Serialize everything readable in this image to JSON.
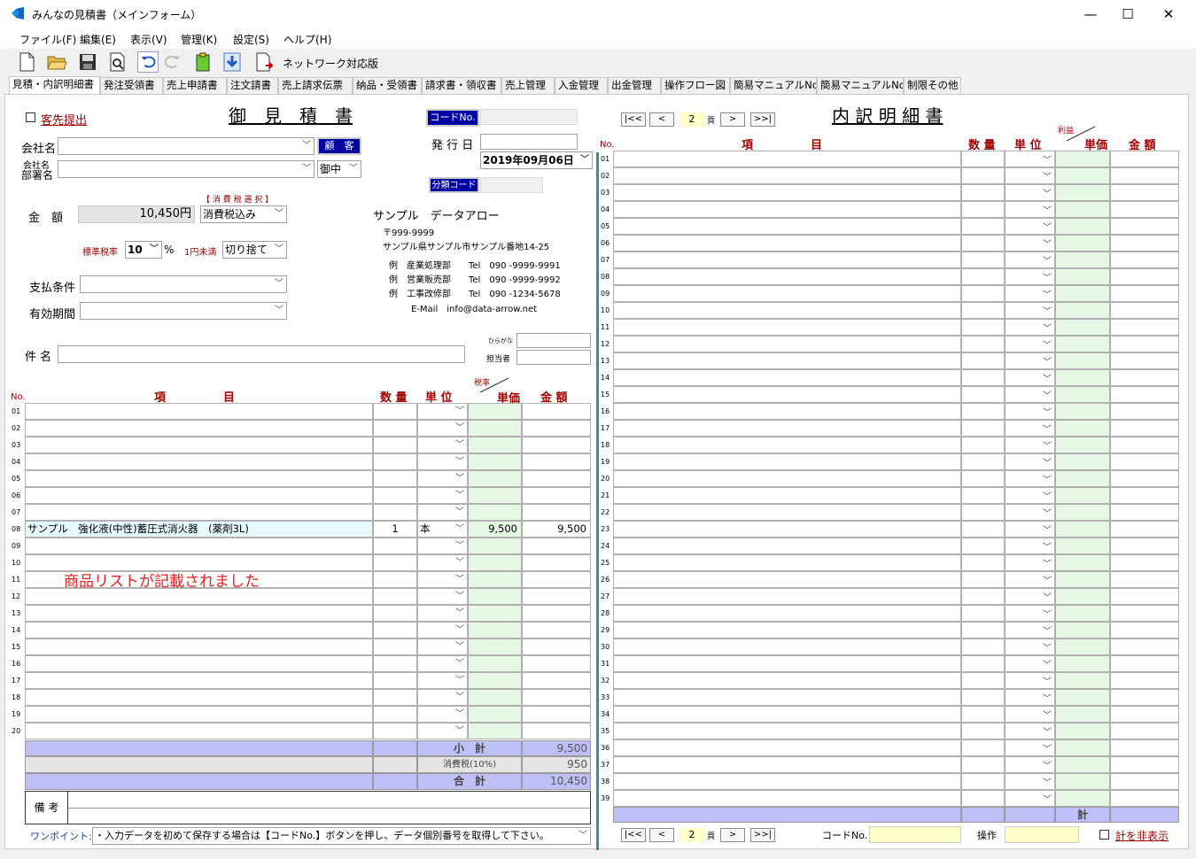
{
  "window": {
    "title": "みんなの見積書（メインフォーム）",
    "minimize": "—",
    "maximize": "☐",
    "close": "✕"
  },
  "menu": [
    "ファイル(F)",
    "編集(E)",
    "表示(V)",
    "管理(K)",
    "設定(S)",
    "ヘルプ(H)"
  ],
  "toolbar": {
    "network_label": "ネットワーク対応版"
  },
  "tabs": [
    "見積・内訳明細書",
    "発注受領書",
    "売上申請書",
    "注文請書",
    "売上請求伝票",
    "納品・受領書",
    "請求書・領収書",
    "売上管理",
    "入金管理",
    "出金管理",
    "操作フロー図",
    "簡易マニュアルNo.1",
    "簡易マニュアルNo.2",
    "制限その他"
  ],
  "left": {
    "checkbox_label": "客先提出",
    "title": "御　見　積　書",
    "code_no_button": "コードNo.",
    "issue_date_label": "発 行 日",
    "issue_date": "2019年09月06日",
    "class_code_button": "分類コード",
    "company_label": "会社名",
    "customer_button": "顧　客",
    "dept_label1": "会社名",
    "dept_label2": "部署名",
    "honorific": "御中",
    "amount_label": "金　額",
    "amount": "10,450円",
    "tax_select_label": "【 消 費 税 選 択 】",
    "tax_mode": "消費税込み",
    "std_rate_label": "標準税率",
    "std_rate": "10",
    "percent": "%",
    "under_yen_label": "1円未満",
    "rounding": "切り捨て",
    "payment_label": "支払条件",
    "validity_label": "有効期間",
    "subject_label": "件 名",
    "hiragana_label": "ひらがな",
    "person_label": "担当者",
    "company_info": {
      "name": "サンプル　データアロー",
      "zip": "〒999-9999",
      "address": "サンプル県サンプル市サンプル番地14-25",
      "line1": "例　産業処理部　　Tel　090 -9999-9991",
      "line2": "例　営業販売部　　Tel　090 -9999-9992",
      "line3": "例　工事改修部　　Tel　090 -1234-5678",
      "email": "E-Mail　info@data-arrow.net"
    },
    "headers": {
      "no": "No.",
      "item": "項　　　　　目",
      "qty": "数 量",
      "unit": "単 位",
      "rate": "税率",
      "price": "単価",
      "amount": "金 額"
    },
    "rows": [
      {
        "no": "01"
      },
      {
        "no": "02"
      },
      {
        "no": "03"
      },
      {
        "no": "04"
      },
      {
        "no": "05"
      },
      {
        "no": "06"
      },
      {
        "no": "07"
      },
      {
        "no": "08",
        "item": "サンプル　強化液(中性)蓄圧式消火器　(薬剤3L)",
        "qty": "1",
        "unit": "本",
        "price": "9,500",
        "amount": "9,500"
      },
      {
        "no": "09"
      },
      {
        "no": "10"
      },
      {
        "no": "11"
      },
      {
        "no": "12"
      },
      {
        "no": "13"
      },
      {
        "no": "14"
      },
      {
        "no": "15"
      },
      {
        "no": "16"
      },
      {
        "no": "17"
      },
      {
        "no": "18"
      },
      {
        "no": "19"
      },
      {
        "no": "20"
      }
    ],
    "annotation": "商品リストが記載されました",
    "subtotal_label": "小　計",
    "subtotal": "9,500",
    "tax_label": "消費税(10%)",
    "tax": "950",
    "total_label": "合　計",
    "total": "10,450",
    "remarks_label": "備 考",
    "onepoint_label": "ワンポイント:",
    "onepoint_text": "・入力データを初めて保存する場合は【コードNo.】ボタンを押し、データ個別番号を取得して下さい。"
  },
  "right": {
    "title": "内 訳 明 細 書",
    "pager": {
      "first": "|<<",
      "prev": "<",
      "page": "2",
      "page_suffix": "頁",
      "next": ">",
      "last": ">>|"
    },
    "headers": {
      "no": "No.",
      "item": "項　　　　　目",
      "qty": "数 量",
      "unit": "単 位",
      "profit": "利益",
      "price": "単価",
      "amount": "金 額"
    },
    "rows": [
      "01",
      "02",
      "03",
      "04",
      "05",
      "06",
      "07",
      "08",
      "09",
      "10",
      "11",
      "12",
      "13",
      "14",
      "15",
      "16",
      "17",
      "18",
      "19",
      "20",
      "21",
      "22",
      "23",
      "24",
      "25",
      "26",
      "27",
      "28",
      "29",
      "30",
      "31",
      "32",
      "33",
      "34",
      "35",
      "36",
      "37",
      "38",
      "39"
    ],
    "sum_label": "計",
    "code_no_label": "コードNo.",
    "operator_label": "操作",
    "hide_total_label": "計を非表示"
  }
}
